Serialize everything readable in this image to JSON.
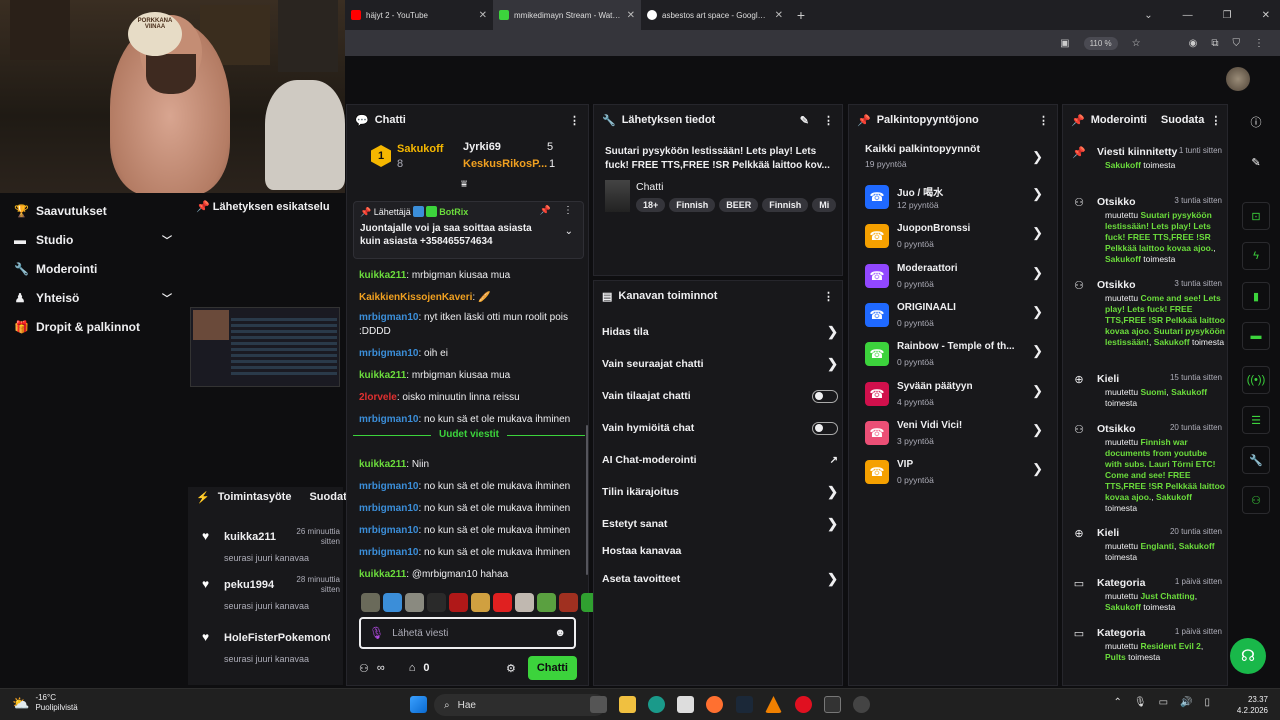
{
  "browser": {
    "tabs": [
      {
        "title": "häjyt 2 - YouTube",
        "color": "#ff0000"
      },
      {
        "title": "mmikedimayn Stream - Watch L",
        "color": "#3cd33c"
      },
      {
        "title": "asbestos art space - Google-ha",
        "color": "#ffffff"
      }
    ],
    "zoom": "110 %"
  },
  "cam": {
    "sign_text": "PORKKANAPRESIDENTTI VIINAA"
  },
  "left_nav": {
    "items": [
      {
        "icon": "trophy-icon",
        "label": "Saavutukset"
      },
      {
        "icon": "studio-icon",
        "label": "Studio"
      },
      {
        "icon": "wrench-icon",
        "label": "Moderointi"
      },
      {
        "icon": "community-icon",
        "label": "Yhteisö"
      },
      {
        "icon": "gift-icon",
        "label": "Dropit & palkinnot"
      }
    ],
    "preview_title": "Lähetyksen esikatselu"
  },
  "activity": {
    "title": "Toimintasyöte",
    "filter": "Suodata",
    "items": [
      {
        "name": "kuikka211",
        "time": "26 minuuttia sitten",
        "sub": "seurasi juuri kanavaa"
      },
      {
        "name": "peku1994",
        "time": "28 minuuttia sitten",
        "sub": "seurasi juuri kanavaa"
      },
      {
        "name": "HoleFisterPokemonGo",
        "time": "",
        "sub": "seurasi juuri kanavaa"
      }
    ]
  },
  "chat": {
    "title": "Chatti",
    "leaderboard": {
      "rank": "1",
      "first": "Sakukoff",
      "first_score": "8",
      "second": "Jyrki69",
      "second_score": "5",
      "third": "KeskusRikosP...",
      "third_score": "1"
    },
    "pinned": {
      "label": "Lähettäjä",
      "user": "BotRix",
      "text": "Juontajalle voi ja saa soittaa asiasta kuin asiasta +358465574634"
    },
    "messages_old": [
      {
        "user": "kuikka211",
        "text": ": mrbigman kiusaa mua",
        "cls": "u-green"
      },
      {
        "user": "KaikkienKissojenKaveri",
        "text": ": 🥖",
        "cls": "u-orange"
      },
      {
        "user": "mrbigman10",
        "text": ": nyt itken läski otti mun roolit pois :DDDD",
        "cls": "u-blue"
      },
      {
        "user": "mrbigman10",
        "text": ": oih ei",
        "cls": "u-blue"
      },
      {
        "user": "kuikka211",
        "text": ": mrbigman kiusaa mua",
        "cls": "u-green"
      },
      {
        "user": "2lorvele",
        "text": ": oisko minuutin linna reissu",
        "cls": "u-red"
      },
      {
        "user": "mrbigman10",
        "text": ": no kun sä et ole mukava ihminen",
        "cls": "u-blue"
      }
    ],
    "new_divider": "Uudet viestit",
    "messages_new": [
      {
        "user": "kuikka211",
        "text": ": Niin",
        "cls": "u-green"
      },
      {
        "user": "mrbigman10",
        "text": ": no kun sä et ole mukava ihminen",
        "cls": "u-blue"
      },
      {
        "user": "mrbigman10",
        "text": ": no kun sä et ole mukava ihminen",
        "cls": "u-blue"
      },
      {
        "user": "mrbigman10",
        "text": ": no kun sä et ole mukava ihminen",
        "cls": "u-blue"
      },
      {
        "user": "mrbigman10",
        "text": ": no kun sä et ole mukava ihminen",
        "cls": "u-blue"
      },
      {
        "user": "kuikka211",
        "text": ": @mrbigman10 hahaa",
        "cls": "u-green"
      }
    ],
    "input_placeholder": "Lähetä viesti",
    "points": "0",
    "send_label": "Chatti"
  },
  "stream_info": {
    "title": "Lähetyksen tiedot",
    "stream_title": "Suutari pysyköön lestissään! Lets play! Lets fuck! FREE TTS,FREE !SR Pelkkää laittoo kov...",
    "category": "Chatti",
    "tags": [
      "18+",
      "Finnish",
      "BEER",
      "Finnish",
      "Mi"
    ]
  },
  "channel_actions": {
    "title": "Kanavan toiminnot",
    "items": [
      {
        "label": "Hidas tila",
        "kind": "chev"
      },
      {
        "label": "Vain seuraajat chatti",
        "kind": "chev"
      },
      {
        "label": "Vain tilaajat chatti",
        "kind": "toggle"
      },
      {
        "label": "Vain hymiöitä chat",
        "kind": "toggle"
      },
      {
        "label": "AI Chat-moderointi",
        "kind": "ext"
      },
      {
        "label": "Tilin ikärajoitus",
        "kind": "chev"
      },
      {
        "label": "Estetyt sanat",
        "kind": "chev"
      },
      {
        "label": "Hostaa kanavaa",
        "kind": "none"
      },
      {
        "label": "Aseta tavoitteet",
        "kind": "chev"
      }
    ]
  },
  "rewards": {
    "title": "Palkintopyyntöjono",
    "all_label": "Kaikki palkintopyynnöt",
    "all_count": "19 pyyntöä",
    "items": [
      {
        "name": "Juo / 喝水",
        "count": "12 pyyntöä",
        "color": "#1f69ff"
      },
      {
        "name": "JuoponBronssi",
        "count": "0 pyyntöä",
        "color": "#f5a000"
      },
      {
        "name": "Moderaattori",
        "count": "0 pyyntöä",
        "color": "#9147ff"
      },
      {
        "name": "ORIGINAALI",
        "count": "0 pyyntöä",
        "color": "#1f69ff"
      },
      {
        "name": "Rainbow - Temple of th...",
        "count": "0 pyyntöä",
        "color": "#3cd33c"
      },
      {
        "name": "Syvään päätyyn",
        "count": "4 pyyntöä",
        "color": "#d0104c"
      },
      {
        "name": "Veni Vidi Vici!",
        "count": "3 pyyntöä",
        "color": "#eb4f76"
      },
      {
        "name": "VIP",
        "count": "0 pyyntöä",
        "color": "#f5a000"
      }
    ]
  },
  "modlog": {
    "title": "Moderointi",
    "filter": "Suodata",
    "items": [
      {
        "icon": "pin-icon",
        "title": "Viesti kiinnitetty",
        "time": "1 tunti sitten",
        "desc": "<b>Sakukoff</b> toimesta"
      },
      {
        "icon": "title-icon",
        "title": "Otsikko",
        "time": "3 tuntia sitten",
        "desc": "muutettu <b>Suutari pysyköön lestissään! Lets play! Lets fuck! FREE TTS,FREE !SR Pelkkää laittoo kovaa ajoo.</b>, <b>Sakukoff</b> toimesta"
      },
      {
        "icon": "title-icon",
        "title": "Otsikko",
        "time": "3 tuntia sitten",
        "desc": "muutettu <b>Come and see! Lets play! Lets fuck! FREE TTS,FREE !SR Pelkkää laittoo kovaa ajoo. Suutari pysyköön lestissään!</b>, <b>Sakukoff</b> toimesta"
      },
      {
        "icon": "globe-icon",
        "title": "Kieli",
        "time": "15 tuntia sitten",
        "desc": "muutettu <b>Suomi</b>, <b>Sakukoff</b> toimesta"
      },
      {
        "icon": "title-icon",
        "title": "Otsikko",
        "time": "20 tuntia sitten",
        "desc": "muutettu <b>Finnish war documents from youtube with subs. Lauri Törni ETC! Come and see! FREE TTS,FREE !SR Pelkkää laittoo kovaa ajoo.</b>, <b>Sakukoff</b> toimesta"
      },
      {
        "icon": "globe-icon",
        "title": "Kieli",
        "time": "20 tuntia sitten",
        "desc": "muutettu <b>Englanti</b>, <b>Sakukoff</b> toimesta"
      },
      {
        "icon": "category-icon",
        "title": "Kategoria",
        "time": "1 päivä sitten",
        "desc": "muutettu <b>Just Chatting</b>, <b>Sakukoff</b> toimesta"
      },
      {
        "icon": "category-icon",
        "title": "Kategoria",
        "time": "1 päivä sitten",
        "desc": "muutettu <b>Resident Evil 2</b>, <b>Pults</b> toimesta"
      }
    ]
  },
  "taskbar": {
    "temp": "-16°C",
    "weather": "Puolipilvistä",
    "search_placeholder": "Hae",
    "time": "23.37",
    "date": "4.2.2026"
  }
}
